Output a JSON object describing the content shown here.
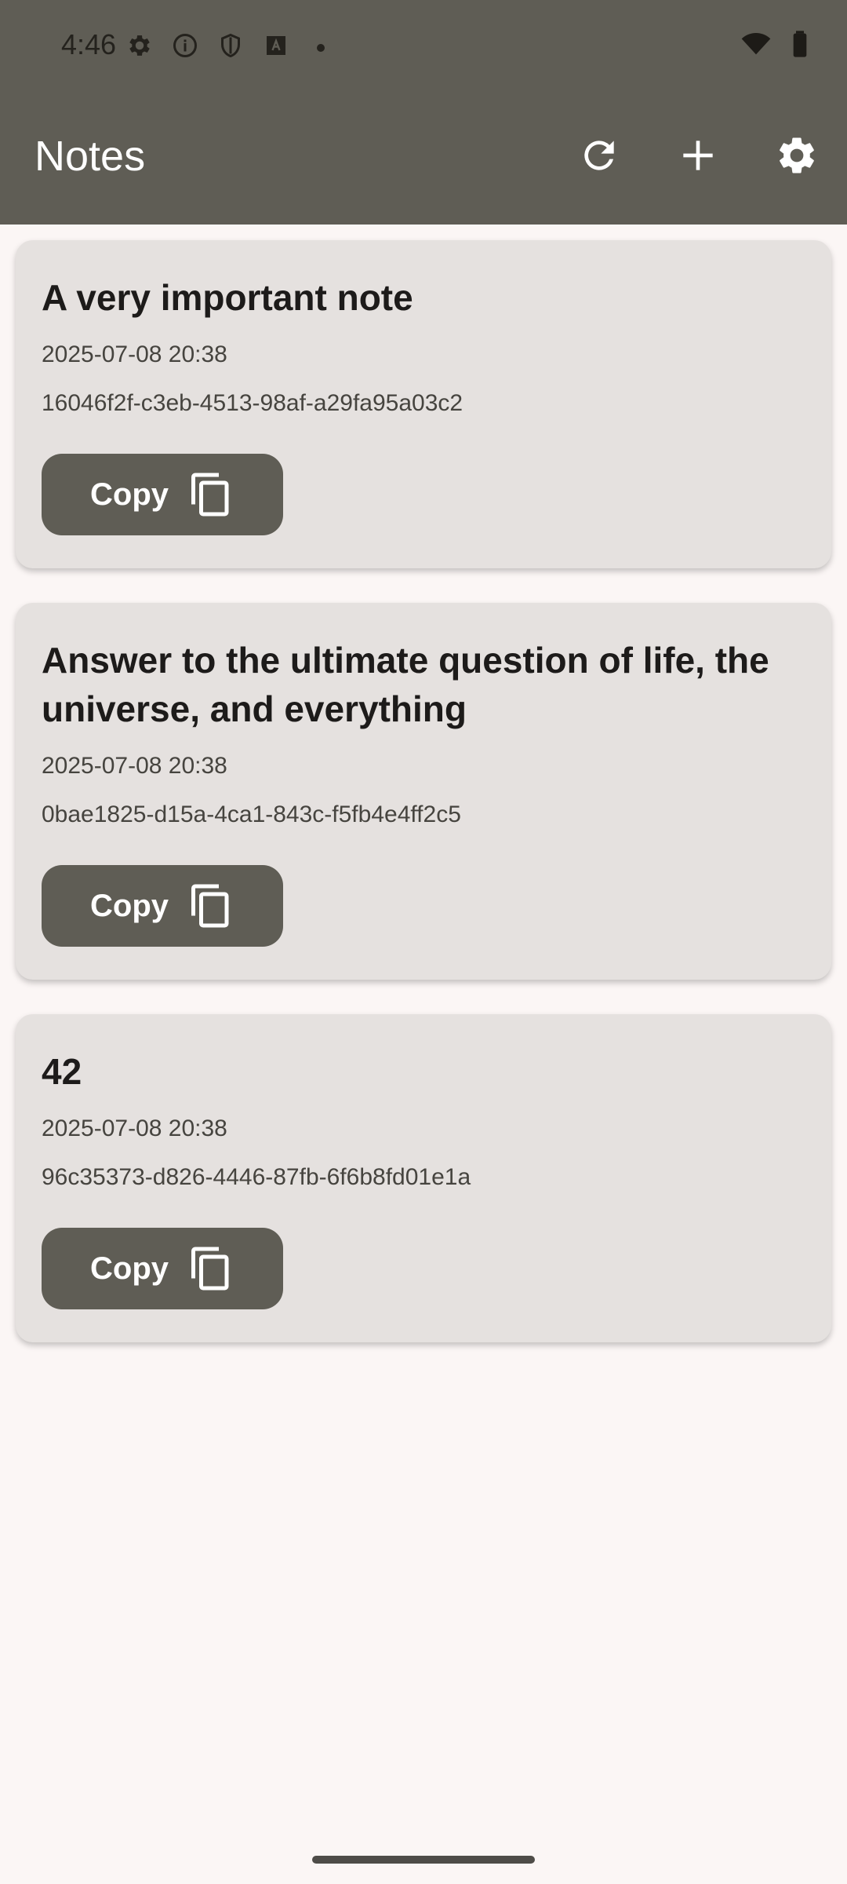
{
  "status_bar": {
    "time": "4:46",
    "icons_left": [
      "gear-icon",
      "info-icon",
      "shield-icon",
      "text-a-icon"
    ],
    "icons_right": [
      "wifi-icon",
      "battery-icon"
    ]
  },
  "app_bar": {
    "title": "Notes",
    "actions": [
      "refresh-icon",
      "add-icon",
      "settings-icon"
    ],
    "color": "#5f5d55"
  },
  "notes": [
    {
      "title": "A very important note",
      "date": "2025-07-08 20:38",
      "id": "16046f2f-c3eb-4513-98af-a29fa95a03c2",
      "copy_label": "Copy"
    },
    {
      "title": "Answer to the ultimate question of life, the universe, and everything",
      "date": "2025-07-08 20:38",
      "id": "0bae1825-d15a-4ca1-843c-f5fb4e4ff2c5",
      "copy_label": "Copy"
    },
    {
      "title": "42",
      "date": "2025-07-08 20:38",
      "id": "96c35373-d826-4446-87fb-6f6b8fd01e1a",
      "copy_label": "Copy"
    }
  ],
  "colors": {
    "card_bg": "#e5e1df",
    "page_bg": "#fbf6f5",
    "button_bg": "#5f5d55"
  }
}
